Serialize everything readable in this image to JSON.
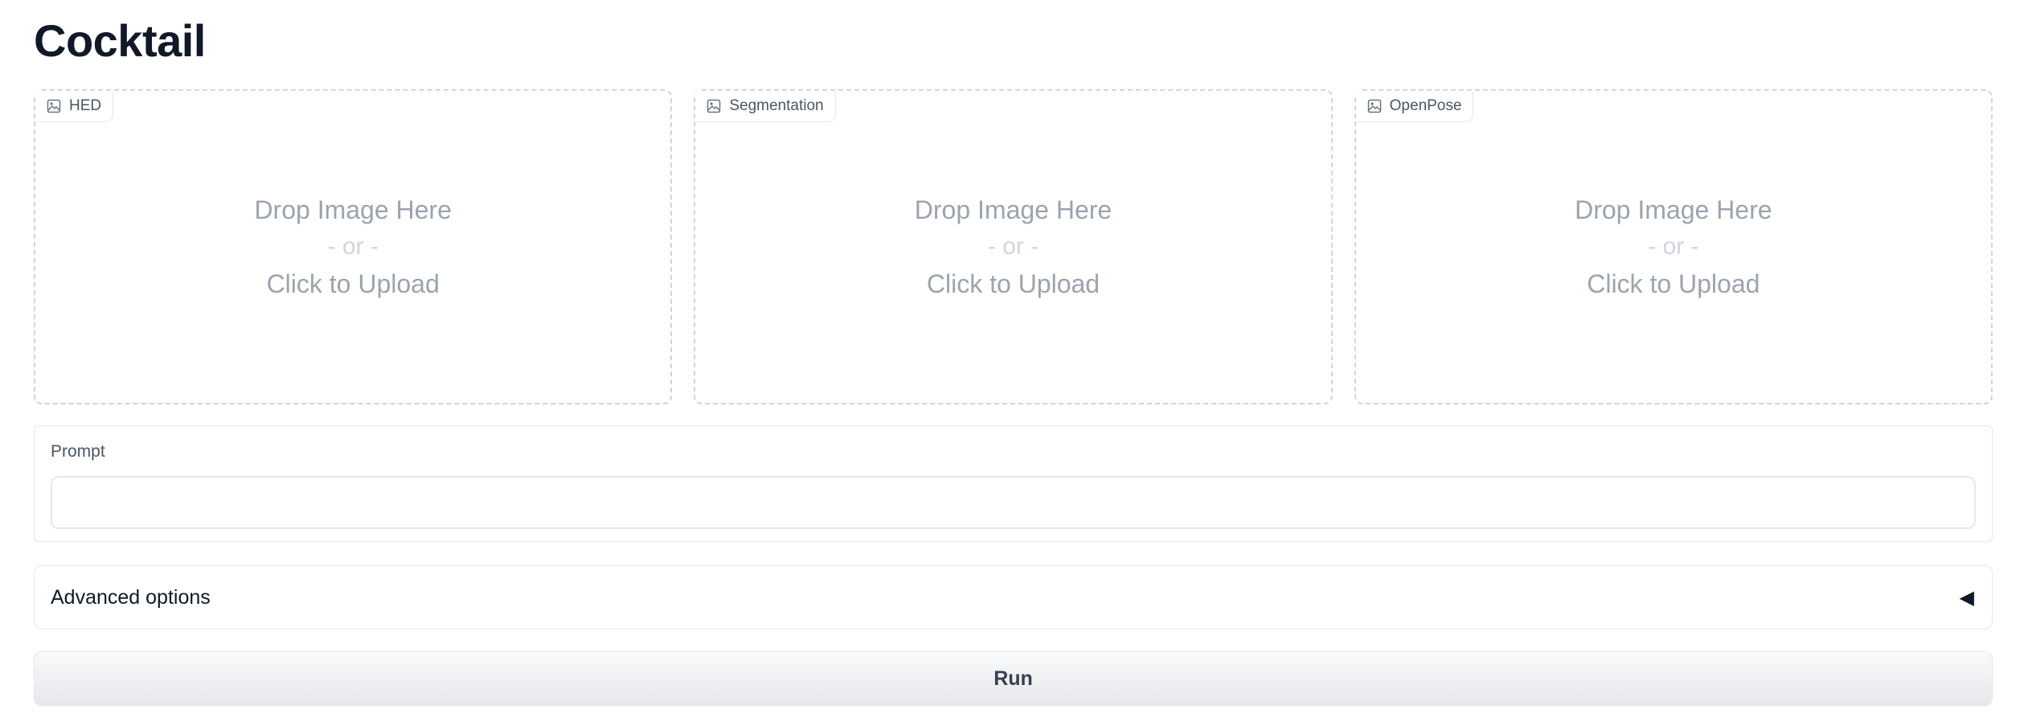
{
  "app": {
    "title": "Cocktail"
  },
  "uploads": [
    {
      "label": "HED",
      "icon": "image-icon",
      "drop_text": "Drop Image Here",
      "or_text": "- or -",
      "click_text": "Click to Upload"
    },
    {
      "label": "Segmentation",
      "icon": "image-icon",
      "drop_text": "Drop Image Here",
      "or_text": "- or -",
      "click_text": "Click to Upload"
    },
    {
      "label": "OpenPose",
      "icon": "image-icon",
      "drop_text": "Drop Image Here",
      "or_text": "- or -",
      "click_text": "Click to Upload"
    }
  ],
  "prompt": {
    "label": "Prompt",
    "value": "",
    "placeholder": ""
  },
  "advanced": {
    "label": "Advanced options",
    "arrow": "◀",
    "arrow_icon": "triangle-left-icon"
  },
  "run": {
    "label": "Run"
  },
  "colors": {
    "border": "#e5e7eb",
    "dashed_border": "#d1d5db",
    "muted_text": "#9ca3af",
    "title_text": "#111827"
  }
}
